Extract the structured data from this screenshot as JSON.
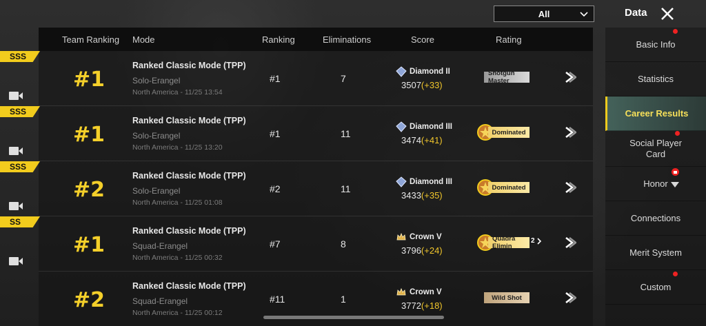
{
  "header": {
    "filter_value": "All",
    "title": "Data",
    "close_icon": "close-icon"
  },
  "table": {
    "columns": [
      "Team Ranking",
      "Mode",
      "Ranking",
      "Eliminations",
      "Score",
      "Rating"
    ],
    "rows": [
      {
        "tag": "SSS",
        "team_rank": "#1",
        "mode": "Ranked Classic Mode (TPP)",
        "map": "Solo-Erangel",
        "when": "North America - 11/25 13:54",
        "ranking": "#1",
        "eliminations": "7",
        "tier": "Diamond II",
        "score": "3507",
        "delta": "(+33)",
        "rating": "Shotgun Master",
        "rating_style": "plain"
      },
      {
        "tag": "SSS",
        "team_rank": "#1",
        "mode": "Ranked Classic Mode (TPP)",
        "map": "Solo-Erangel",
        "when": "North America - 11/25 13:20",
        "ranking": "#1",
        "eliminations": "11",
        "tier": "Diamond III",
        "score": "3474",
        "delta": "(+41)",
        "rating": "Dominated",
        "rating_style": "gold"
      },
      {
        "tag": "SSS",
        "team_rank": "#2",
        "mode": "Ranked Classic Mode (TPP)",
        "map": "Solo-Erangel",
        "when": "North America - 11/25 01:08",
        "ranking": "#2",
        "eliminations": "11",
        "tier": "Diamond III",
        "score": "3433",
        "delta": "(+35)",
        "rating": "Dominated",
        "rating_style": "gold"
      },
      {
        "tag": "SS",
        "team_rank": "#1",
        "mode": "Ranked Classic Mode (TPP)",
        "map": "Squad-Erangel",
        "when": "North America - 11/25 00:32",
        "ranking": "#7",
        "eliminations": "8",
        "tier": "Crown V",
        "score": "3796",
        "delta": "(+24)",
        "rating": "Quadra Elimin",
        "rating_style": "gold",
        "rating_count": "2"
      },
      {
        "tag": "",
        "team_rank": "#2",
        "mode": "Ranked Classic Mode (TPP)",
        "map": "Squad-Erangel",
        "when": "North America - 11/25 00:12",
        "ranking": "#11",
        "eliminations": "1",
        "tier": "Crown V",
        "score": "3772",
        "delta": "(+18)",
        "rating": "Wild Shot",
        "rating_style": "tan"
      }
    ]
  },
  "sidebar": {
    "items": [
      {
        "label": "Basic Info",
        "badge": true
      },
      {
        "label": "Statistics",
        "badge": false
      },
      {
        "label": "Career Results",
        "badge": true,
        "active": true
      },
      {
        "label": "Social Player Card",
        "badge": false
      },
      {
        "label": "Honor",
        "badge": false
      },
      {
        "label": "Connections",
        "badge": false
      },
      {
        "label": "Merit System",
        "badge": false
      },
      {
        "label": "Custom",
        "badge": true
      }
    ]
  },
  "colors": {
    "accent_yellow": "#f2cc1d",
    "active_tab_bg": "#4f7a70",
    "badge_red": "#e22222"
  }
}
